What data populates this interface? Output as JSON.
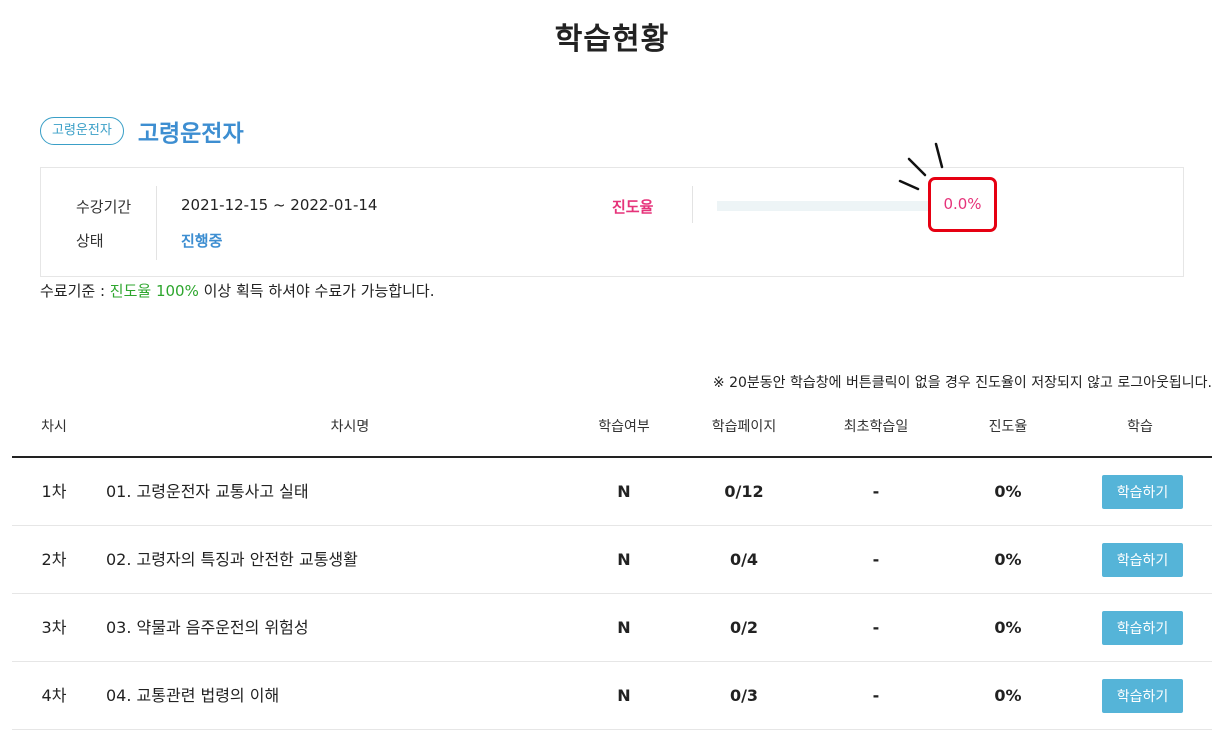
{
  "page": {
    "title": "학습현황"
  },
  "course": {
    "badge": "고령운전자",
    "name": "고령운전자"
  },
  "info": {
    "period_label": "수강기간",
    "period_value": "2021-12-15 ~ 2022-01-14",
    "status_label": "상태",
    "status_value": "진행중",
    "progress_label": "진도율",
    "progress_value": "0.0%",
    "progress_fraction": 0.0
  },
  "criteria": {
    "prefix": "수료기준 : ",
    "highlight": "진도율 100%",
    "suffix": " 이상 획득 하셔야 수료가 가능합니다."
  },
  "notice": "※ 20분동안 학습창에 버튼클릭이 없을 경우 진도율이 저장되지 않고 로그아웃됩니다.",
  "table": {
    "headers": [
      "차시",
      "차시명",
      "학습여부",
      "학습페이지",
      "최초학습일",
      "진도율",
      "학습"
    ],
    "rows": [
      {
        "no": "1차",
        "name": "01. 고령운전자 교통사고 실태",
        "done": "N",
        "pages": "0/12",
        "first": "-",
        "progress": "0%",
        "button": "학습하기"
      },
      {
        "no": "2차",
        "name": "02. 고령자의 특징과 안전한 교통생활",
        "done": "N",
        "pages": "0/4",
        "first": "-",
        "progress": "0%",
        "button": "학습하기"
      },
      {
        "no": "3차",
        "name": "03. 약물과 음주운전의 위험성",
        "done": "N",
        "pages": "0/2",
        "first": "-",
        "progress": "0%",
        "button": "학습하기"
      },
      {
        "no": "4차",
        "name": "04. 교통관련 법령의 이해",
        "done": "N",
        "pages": "0/3",
        "first": "-",
        "progress": "0%",
        "button": "학습하기"
      }
    ]
  },
  "colors": {
    "accent_blue": "#3d8ed1",
    "button_blue": "#55b4d8",
    "progress_pink": "#e6337a",
    "highlight_red": "#e60012",
    "criteria_green": "#2ea62e"
  }
}
